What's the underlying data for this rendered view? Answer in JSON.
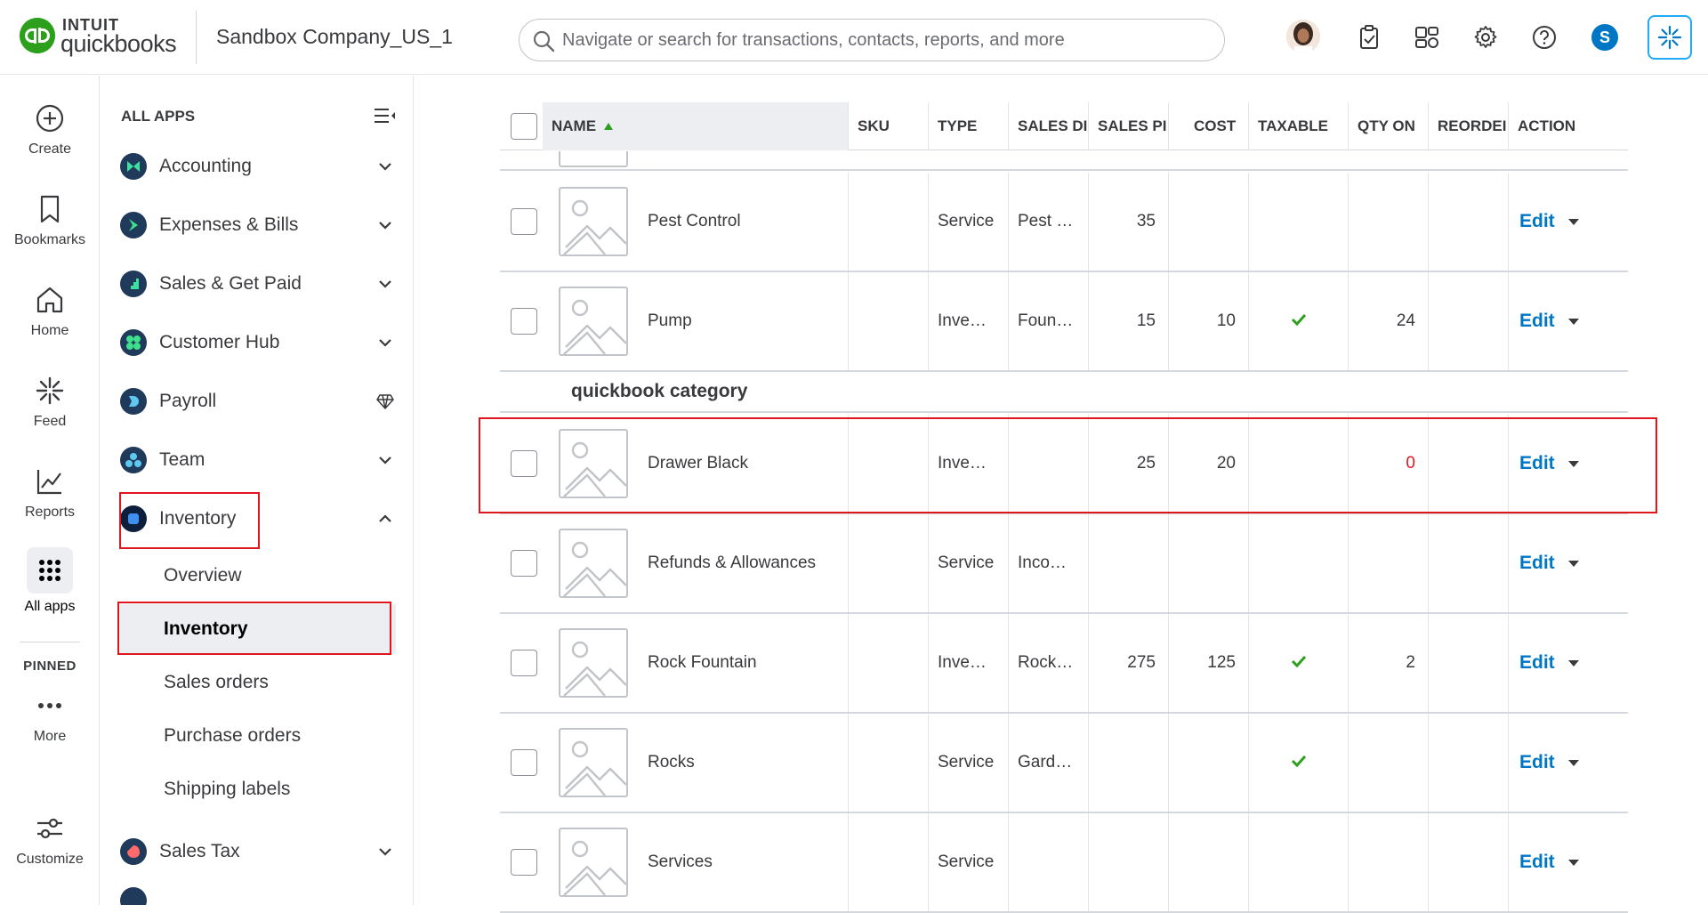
{
  "brand": {
    "intuit": "INTUIT",
    "product": "quickbooks"
  },
  "company": "Sandbox Company_US_1",
  "search": {
    "placeholder": "Navigate or search for transactions, contacts, reports, and more"
  },
  "user_initial": "S",
  "rail": {
    "items": [
      {
        "label": "Create",
        "icon": "plus-circle-icon"
      },
      {
        "label": "Bookmarks",
        "icon": "bookmark-icon"
      },
      {
        "label": "Home",
        "icon": "home-icon"
      },
      {
        "label": "Feed",
        "icon": "feed-icon"
      },
      {
        "label": "Reports",
        "icon": "reports-icon"
      },
      {
        "label": "All apps",
        "icon": "grid-icon"
      },
      {
        "label": "More",
        "icon": "more-icon"
      },
      {
        "label": "Customize",
        "icon": "sliders-icon"
      }
    ],
    "pinned_label": "PINNED"
  },
  "menu": {
    "heading": "ALL APPS",
    "apps": [
      {
        "label": "Accounting"
      },
      {
        "label": "Expenses & Bills"
      },
      {
        "label": "Sales & Get Paid"
      },
      {
        "label": "Customer Hub"
      },
      {
        "label": "Payroll"
      },
      {
        "label": "Team"
      },
      {
        "label": "Inventory"
      },
      {
        "label": "Sales Tax"
      }
    ],
    "inventory_sub": [
      {
        "label": "Overview"
      },
      {
        "label": "Inventory"
      },
      {
        "label": "Sales orders"
      },
      {
        "label": "Purchase orders"
      },
      {
        "label": "Shipping labels"
      }
    ]
  },
  "table": {
    "columns": [
      "NAME",
      "SKU",
      "TYPE",
      "SALES DI",
      "SALES PI",
      "COST",
      "TAXABLE",
      "QTY ON",
      "REORDEI",
      "ACTION"
    ],
    "edit_label": "Edit",
    "rows": [
      {
        "name": "Pest Control",
        "type": "Service",
        "sales_desc": "Pest …",
        "sales_price": "35",
        "cost": "",
        "taxable": false,
        "qty": "",
        "reorder": ""
      },
      {
        "name": "Pump",
        "type": "Inve…",
        "sales_desc": "Foun…",
        "sales_price": "15",
        "cost": "10",
        "taxable": true,
        "qty": "24",
        "reorder": ""
      }
    ],
    "category": "quickbook category",
    "rows2": [
      {
        "name": "Drawer Black",
        "type": "Inve…",
        "sales_desc": "",
        "sales_price": "25",
        "cost": "20",
        "taxable": false,
        "qty": "0",
        "reorder": ""
      },
      {
        "name": "Refunds & Allowances",
        "type": "Service",
        "sales_desc": "Inco…",
        "sales_price": "",
        "cost": "",
        "taxable": false,
        "qty": "",
        "reorder": ""
      },
      {
        "name": "Rock Fountain",
        "type": "Inve…",
        "sales_desc": "Rock…",
        "sales_price": "275",
        "cost": "125",
        "taxable": true,
        "qty": "2",
        "reorder": ""
      },
      {
        "name": "Rocks",
        "type": "Service",
        "sales_desc": "Gard…",
        "sales_price": "",
        "cost": "",
        "taxable": true,
        "qty": "",
        "reorder": ""
      },
      {
        "name": "Services",
        "type": "Service",
        "sales_desc": "",
        "sales_price": "",
        "cost": "",
        "taxable": false,
        "qty": "",
        "reorder": ""
      }
    ]
  },
  "colors": {
    "brand_green": "#2ca01c",
    "link_blue": "#0077c5",
    "highlight_red": "#e0161e"
  }
}
